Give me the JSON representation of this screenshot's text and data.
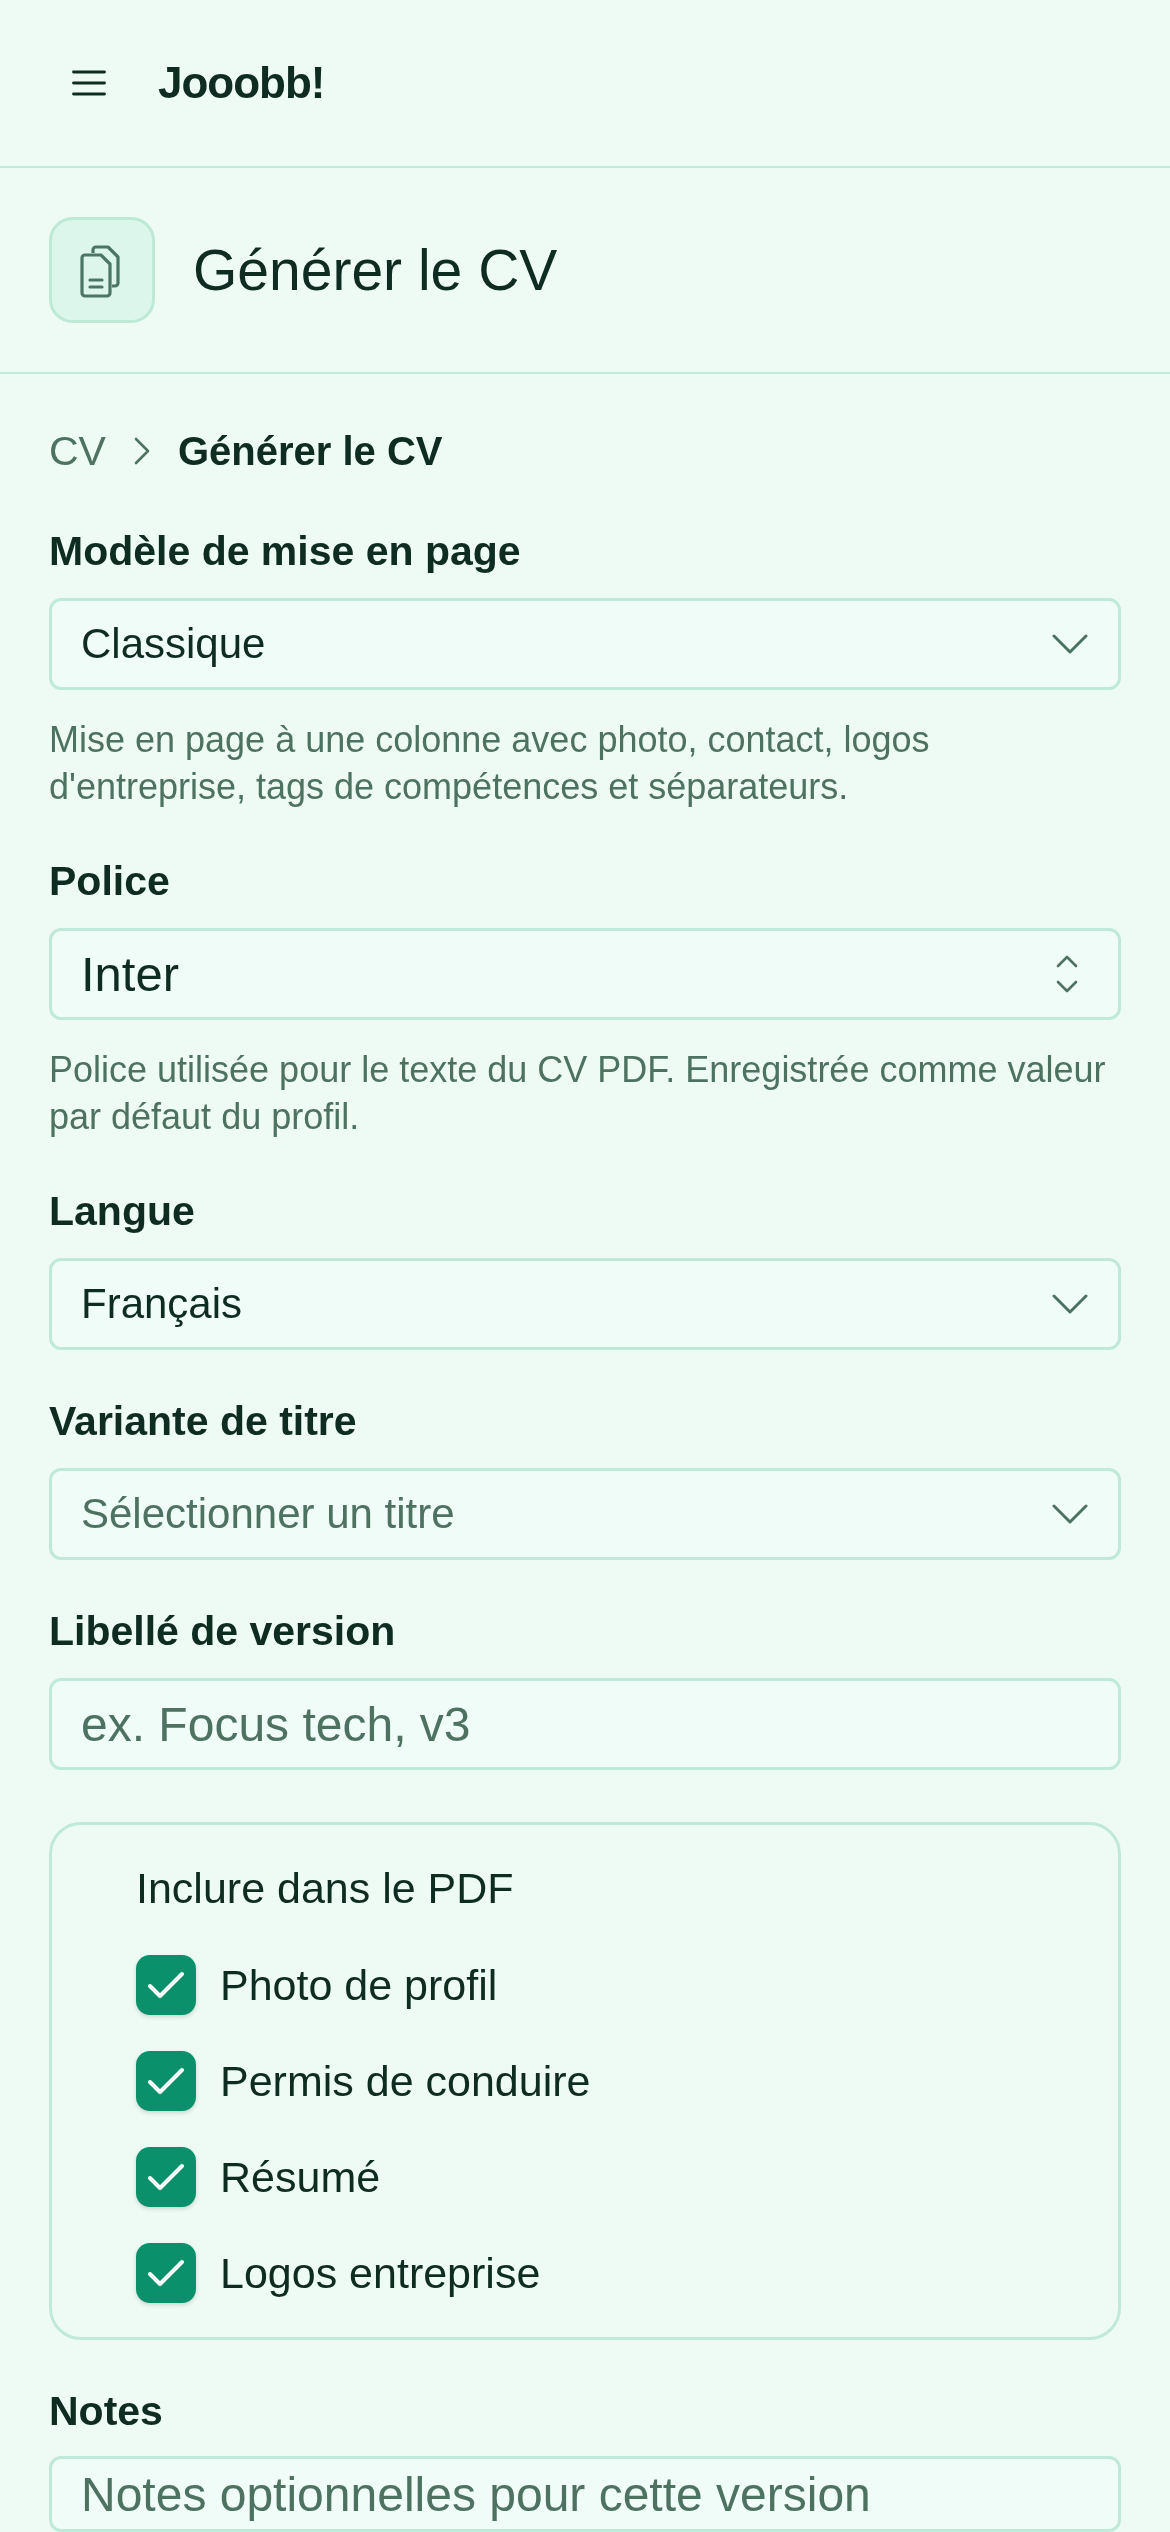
{
  "header": {
    "app_name": "Jooobb!"
  },
  "page_header": {
    "title": "Générer le CV"
  },
  "breadcrumb": [
    {
      "label": "CV",
      "current": false
    },
    {
      "label": "Générer le CV",
      "current": true
    }
  ],
  "fields": [
    {
      "kind": "dropdown",
      "label": "Modèle de mise en page",
      "value": "Classique",
      "help": "Mise en page à une colonne avec photo, contact, logos d'entreprise, tags de compétences et séparateurs."
    },
    {
      "kind": "picker",
      "label": "Police",
      "value": "Inter",
      "help": "Police utilisée pour le texte du CV PDF. Enregistrée comme valeur par défaut du profil."
    },
    {
      "kind": "dropdown",
      "label": "Langue",
      "value": "Français"
    },
    {
      "kind": "dropdown",
      "label": "Variante de titre",
      "placeholder": "Sélectionner un titre"
    },
    {
      "kind": "text",
      "label": "Libellé de version",
      "placeholder": "ex. Focus tech, v3"
    }
  ],
  "include_in_pdf": {
    "title": "Inclure dans le PDF",
    "options": [
      {
        "label": "Photo de profil",
        "checked": true
      },
      {
        "label": "Permis de conduire",
        "checked": true
      },
      {
        "label": "Résumé",
        "checked": true
      },
      {
        "label": "Logos entreprise",
        "checked": true
      }
    ]
  },
  "notes": {
    "label": "Notes",
    "placeholder": "Notes optionnelles pour cette version"
  }
}
